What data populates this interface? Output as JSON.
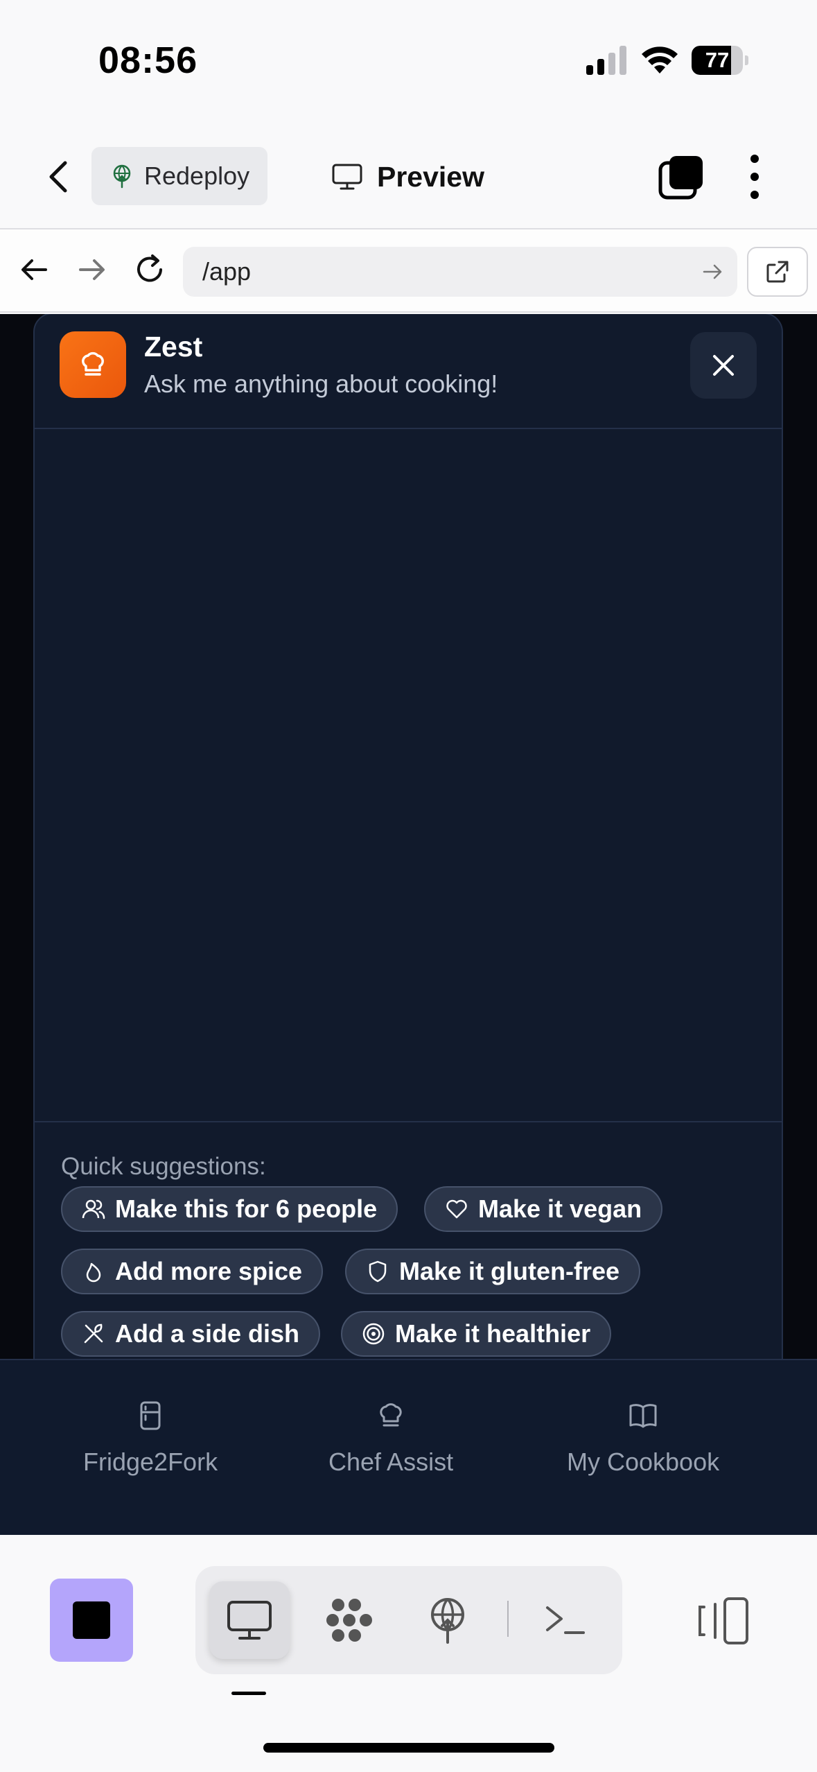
{
  "status_bar": {
    "time": "08:56",
    "battery_level": "77",
    "battery_fraction": 0.77,
    "signal_icon": "cellular-signal-icon",
    "wifi_icon": "wifi-icon"
  },
  "app_bar": {
    "redeploy_label": "Redeploy",
    "preview_label": "Preview"
  },
  "browser": {
    "url": "/app"
  },
  "chat": {
    "title": "Zest",
    "subtitle": "Ask me anything about cooking!",
    "accent_color": "#f97316",
    "suggestions_heading": "Quick suggestions:",
    "suggestions": [
      {
        "label": "Make this for 6 people",
        "icon": "users-icon"
      },
      {
        "label": "Make it vegan",
        "icon": "heart-icon"
      },
      {
        "label": "Add more spice",
        "icon": "flame-icon"
      },
      {
        "label": "Make it gluten-free",
        "icon": "shield-icon"
      },
      {
        "label": "Add a side dish",
        "icon": "utensils-icon"
      },
      {
        "label": "Make it healthier",
        "icon": "target-icon"
      }
    ]
  },
  "web_nav": {
    "items": [
      {
        "label": "Fridge2Fork",
        "icon": "fridge-icon"
      },
      {
        "label": "Chef Assist",
        "icon": "chef-hat-icon"
      },
      {
        "label": "My Cookbook",
        "icon": "book-icon"
      }
    ]
  },
  "ide_toolbar": {
    "stop_color": "#b4a5fb",
    "tools": [
      "preview-icon",
      "workspace-icon",
      "deploy-icon",
      "terminal-icon"
    ]
  }
}
